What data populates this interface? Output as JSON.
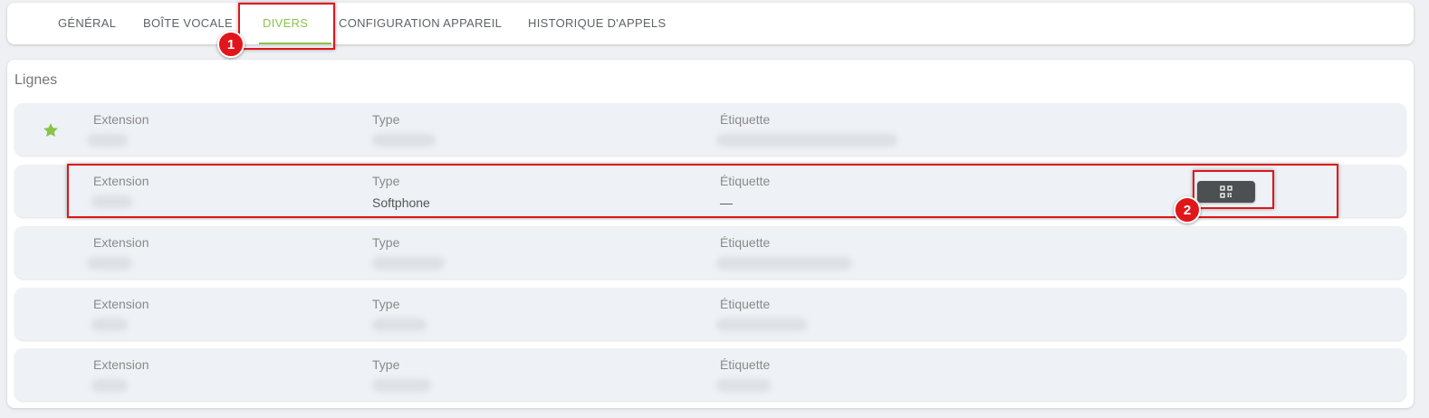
{
  "tabs": [
    {
      "label": "GÉNÉRAL",
      "active": false
    },
    {
      "label": "BOÎTE VOCALE",
      "active": false
    },
    {
      "label": "DIVERS",
      "active": true
    },
    {
      "label": "CONFIGURATION APPAREIL",
      "active": false
    },
    {
      "label": "HISTORIQUE D'APPELS",
      "active": false
    }
  ],
  "section": {
    "title": "Lignes"
  },
  "columns": {
    "extension": "Extension",
    "type": "Type",
    "label": "Étiquette"
  },
  "lines": [
    {
      "favorite": true,
      "type": "",
      "label": ""
    },
    {
      "favorite": false,
      "type": "Softphone",
      "label": "—",
      "action_icon": "qr-code-icon"
    },
    {
      "favorite": false,
      "type": "",
      "label": ""
    },
    {
      "favorite": false,
      "type": "",
      "label": ""
    },
    {
      "favorite": false,
      "type": "",
      "label": ""
    }
  ],
  "annotations": [
    {
      "number": "1"
    },
    {
      "number": "2"
    }
  ],
  "colors": {
    "accent": "#8bc34a",
    "highlight": "#e0161b",
    "button": "#4d5052"
  }
}
